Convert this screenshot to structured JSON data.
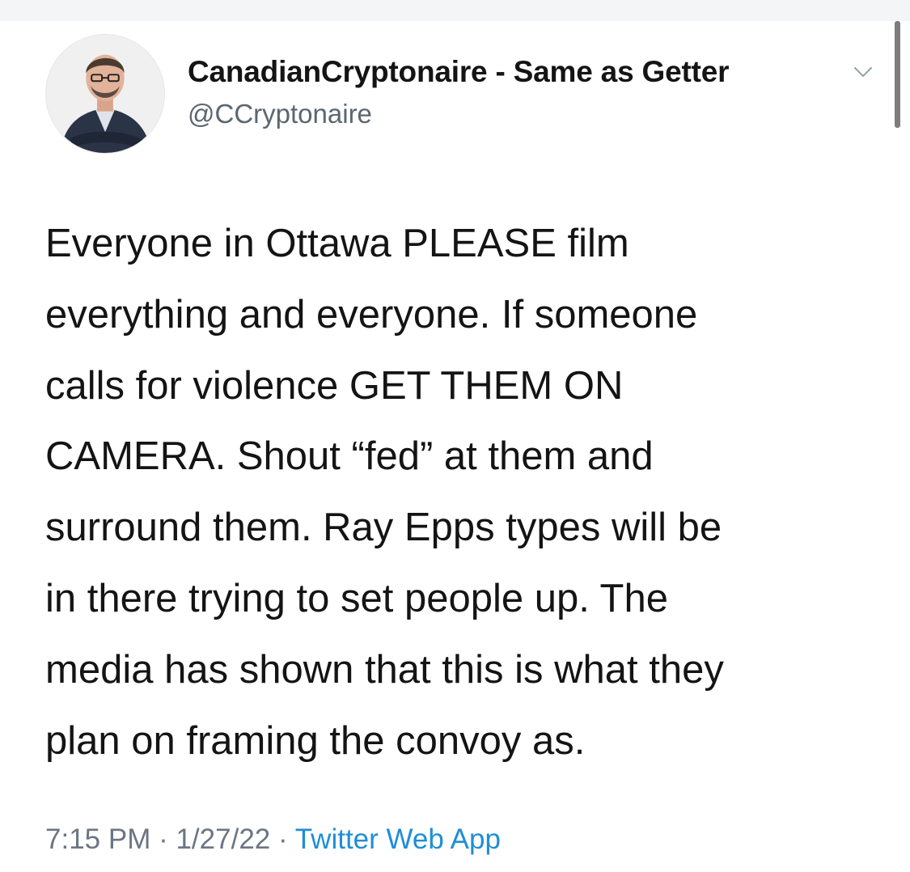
{
  "user": {
    "display_name": "CanadianCryptonaire - Same as Getter",
    "handle": "@CCryptonaire",
    "avatar_icon": "user-avatar-photo",
    "menu_icon": "chevron-down-icon"
  },
  "tweet": {
    "lines": [
      "Everyone in Ottawa PLEASE film",
      "everything and everyone. If someone",
      "calls for violence GET THEM ON",
      "CAMERA. Shout “fed” at them and",
      "surround them. Ray Epps types will be",
      "in there trying to set people up. The",
      "media has shown that this is what they",
      "plan on framing the convoy as."
    ]
  },
  "meta": {
    "time": "7:15 PM",
    "separator": " · ",
    "date": "1/27/22",
    "source": "Twitter Web App"
  },
  "colors": {
    "text": "#141414",
    "muted": "#5b6670",
    "link": "#1f8ed6"
  }
}
